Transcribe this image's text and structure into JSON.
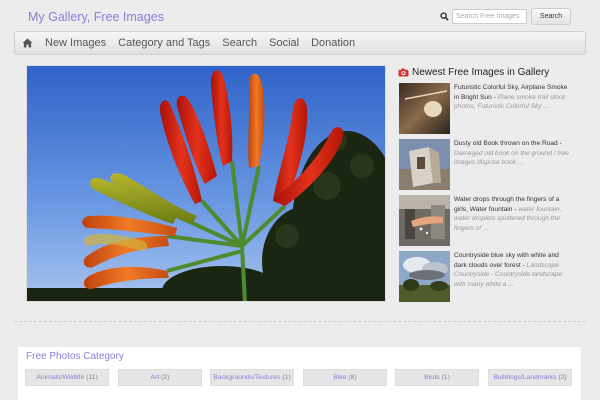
{
  "header": {
    "site_title": "My Gallery, Free Images",
    "search_placeholder": "Search Free Images",
    "search_button": "Search"
  },
  "nav": {
    "home_icon": "home-icon",
    "items": [
      {
        "label": "New Images"
      },
      {
        "label": "Category and Tags"
      },
      {
        "label": "Search"
      },
      {
        "label": "Social"
      },
      {
        "label": "Donation"
      }
    ]
  },
  "hero": {
    "description": "red chili peppers against blue sky"
  },
  "sidebar": {
    "heading": "Newest Free Images in Gallery",
    "heading_icon": "camera-icon",
    "heading_icon_color": "#d9322b",
    "posts": [
      {
        "title": "Futuristic Colorful Sky, Airplane Smoke in Bright Sun",
        "separator": " - ",
        "description": "Plane smoke trail stock photos, Futuristic Colorful Sky ..."
      },
      {
        "title": "Dusty old Book thrown on the Road",
        "separator": " - ",
        "description": "Damaged old book on the ground / free images dispose book ..."
      },
      {
        "title": "Water drops through the fingers of a girls, Water fountain",
        "separator": " - ",
        "description": "water fountain, water droplets sputtered through the fingers of ..."
      },
      {
        "title": "Countryside blue sky with white and dark clouds over forest",
        "separator": " - ",
        "description": "Landscape Countryside - Countryside landscape with many white a ..."
      }
    ]
  },
  "categories": {
    "title": "Free Photos Category",
    "items": [
      {
        "name": "Animals/Wildlife",
        "count": "(11)"
      },
      {
        "name": "Art",
        "count": "(2)"
      },
      {
        "name": "Backgrounds/Textures",
        "count": "(1)"
      },
      {
        "name": "Bike",
        "count": "(8)"
      },
      {
        "name": "Birds",
        "count": "(1)"
      },
      {
        "name": "Buildings/Landmarks",
        "count": "(2)"
      }
    ]
  },
  "colors": {
    "accent": "#8a7fd6",
    "background": "#ececec"
  }
}
